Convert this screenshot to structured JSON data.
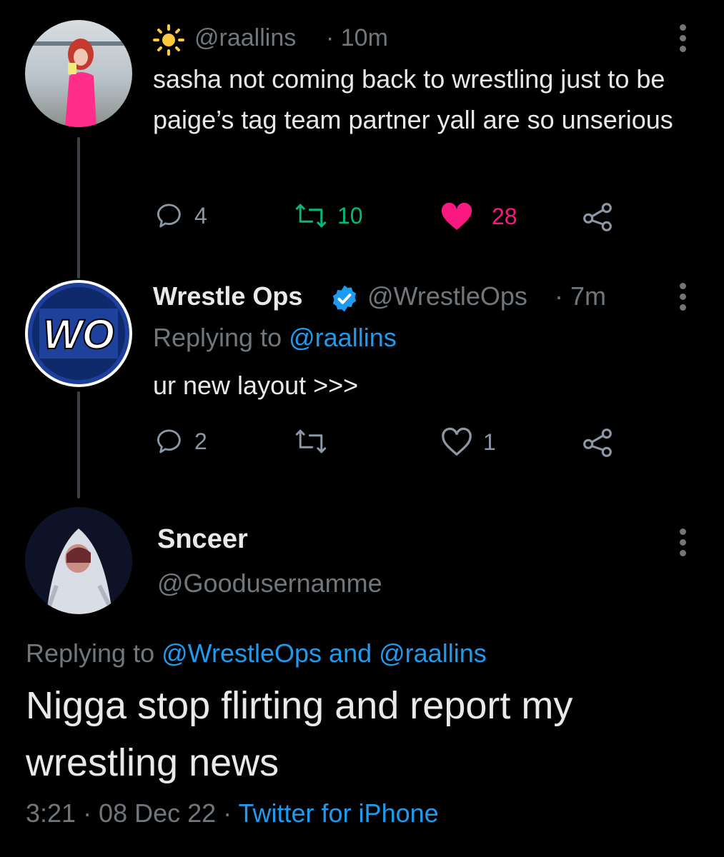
{
  "tweet1": {
    "handle": "@raallins",
    "time": "· 10m",
    "text": "sasha not coming back to wrestling just to be paige’s tag team partner yall are so unserious",
    "replies": "4",
    "retweets": "10",
    "likes": "28",
    "colors": {
      "retweet": "#00ba7c",
      "like": "#f91880"
    }
  },
  "tweet2": {
    "name": "Wrestle Ops",
    "handle": "@WrestleOps",
    "time": "· 7m",
    "replying_prefix": "Replying to",
    "replying_handle": "@raallins",
    "text": "ur new layout >>>",
    "replies": "2",
    "likes": "1",
    "avatar_text": "WO"
  },
  "tweet3": {
    "name": "Snceer",
    "handle": "@Goodusernamme",
    "replying_prefix": "Replying to",
    "replying_handles": "@WrestleOps and @raallins",
    "text": "Nigga stop flirting and report my wrestling news",
    "time": "3:21 · 08 Dec 22 ·",
    "source": "Twitter for iPhone"
  },
  "icons": [
    "sun-icon",
    "reply-icon",
    "retweet-icon",
    "heart-icon",
    "share-icon",
    "verified-icon",
    "more-icon"
  ]
}
